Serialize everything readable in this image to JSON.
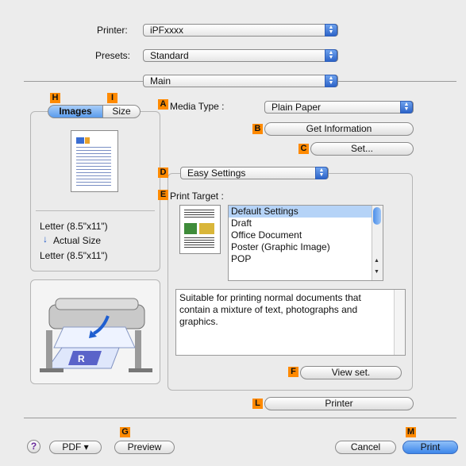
{
  "header": {
    "printer_label": "Printer:",
    "printer_value": "iPFxxxx",
    "presets_label": "Presets:",
    "presets_value": "Standard",
    "panel_value": "Main"
  },
  "tags": {
    "A": "A",
    "B": "B",
    "C": "C",
    "D": "D",
    "E": "E",
    "F": "F",
    "G": "G",
    "H": "H",
    "I": "I",
    "L": "L",
    "M": "M"
  },
  "preview": {
    "tab_images": "Images",
    "tab_size": "Size",
    "paper_line1": "Letter (8.5\"x11\")",
    "actual_size": "Actual Size",
    "paper_line2": "Letter (8.5\"x11\")"
  },
  "main": {
    "media_type_label": "Media Type :",
    "media_type_value": "Plain Paper",
    "get_information_label": "Get Information",
    "set_label": "Set...",
    "settings_mode_value": "Easy Settings",
    "print_target_label": "Print Target :",
    "print_targets": [
      "Default Settings",
      "Draft",
      "Office Document",
      "Poster (Graphic Image)",
      "POP"
    ],
    "selected_target": "Default Settings",
    "description": "Suitable for printing normal documents that contain a mixture of text, photographs and graphics.",
    "view_set_label": "View set.",
    "printer_button_label": "Printer"
  },
  "footer": {
    "help_label": "?",
    "pdf_label": "PDF ▾",
    "preview_label": "Preview",
    "cancel_label": "Cancel",
    "print_label": "Print"
  },
  "colors": {
    "tag": "#ff8a00",
    "accent_blue": "#3d86ea",
    "list_selection": "#b5d3f7"
  }
}
